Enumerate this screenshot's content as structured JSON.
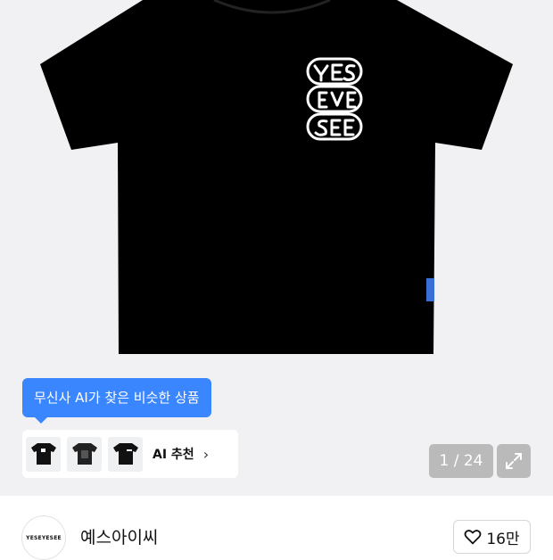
{
  "ai_tooltip": "무신사 AI가 찾은 비슷한 상품",
  "ai_recommend": {
    "label": "AI 추천"
  },
  "image_counter": "1 / 24",
  "brand": {
    "logo_text": "YESEYESEE",
    "name": "예스아이씨"
  },
  "like": {
    "count": "16만"
  },
  "colors": {
    "accent": "#3a86ff",
    "hero_bg": "#f1f1f3",
    "shirt": "#000000"
  }
}
